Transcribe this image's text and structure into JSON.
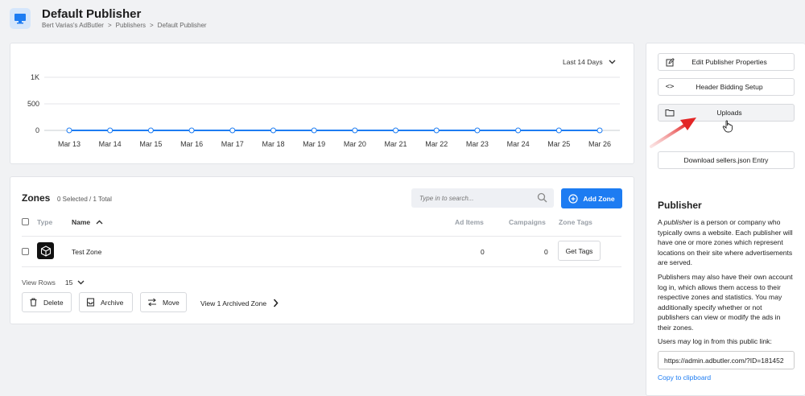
{
  "header": {
    "title": "Default Publisher",
    "breadcrumbs": [
      "Bert Varias's AdButler",
      ">",
      "Publishers",
      ">",
      "Default Publisher"
    ]
  },
  "chart_range": "Last 14 Days",
  "chart_data": {
    "type": "line",
    "categories": [
      "Mar 13",
      "Mar 14",
      "Mar 15",
      "Mar 16",
      "Mar 17",
      "Mar 18",
      "Mar 19",
      "Mar 20",
      "Mar 21",
      "Mar 22",
      "Mar 23",
      "Mar 24",
      "Mar 25",
      "Mar 26"
    ],
    "values": [
      0,
      0,
      0,
      0,
      0,
      0,
      0,
      0,
      0,
      0,
      0,
      0,
      0,
      0
    ],
    "yticks": [
      "1K",
      "500",
      "0"
    ],
    "ylim": [
      0,
      1000
    ],
    "grid": true,
    "color": "#1d7cf2"
  },
  "zones": {
    "title": "Zones",
    "count": "0 Selected / 1 Total",
    "search_placeholder": "Type in to search...",
    "add_label": "Add Zone",
    "columns": {
      "type": "Type",
      "name": "Name",
      "ad_items": "Ad Items",
      "campaigns": "Campaigns",
      "zone_tags": "Zone Tags"
    },
    "rows": [
      {
        "name": "Test Zone",
        "ad_items": "0",
        "campaigns": "0",
        "tags_button": "Get Tags"
      }
    ],
    "view_rows_label": "View Rows",
    "view_rows_value": "15",
    "actions": {
      "delete": "Delete",
      "archive": "Archive",
      "move": "Move"
    },
    "archived_link": "View 1 Archived Zone"
  },
  "side": {
    "buttons": [
      {
        "label": "Edit Publisher Properties",
        "icon": "edit-icon"
      },
      {
        "label": "Header Bidding Setup",
        "icon": "code-icon"
      },
      {
        "label": "Uploads",
        "icon": "folder-icon"
      },
      {
        "label": "Download sellers.json Entry",
        "icon": ""
      }
    ],
    "publisher_title": "Publisher",
    "p1_pre": "A ",
    "p1_em": "publisher",
    "p1_post": " is a person or company who typically owns a website. Each publisher will have one or more zones which represent locations on their site where advertisements are served.",
    "p2": "Publishers may also have their own account log in, which allows them access to their respective zones and statistics. You may additionally specify whether or not publishers can view or modify the ads in their zones.",
    "p3": "Users may log in from this public link:",
    "public_link": "https://admin.adbutler.com/?ID=181452",
    "copy_label": "Copy to clipboard"
  },
  "colors": {
    "accent": "#1d7cf2",
    "annotation_arrow": "#e32626"
  }
}
